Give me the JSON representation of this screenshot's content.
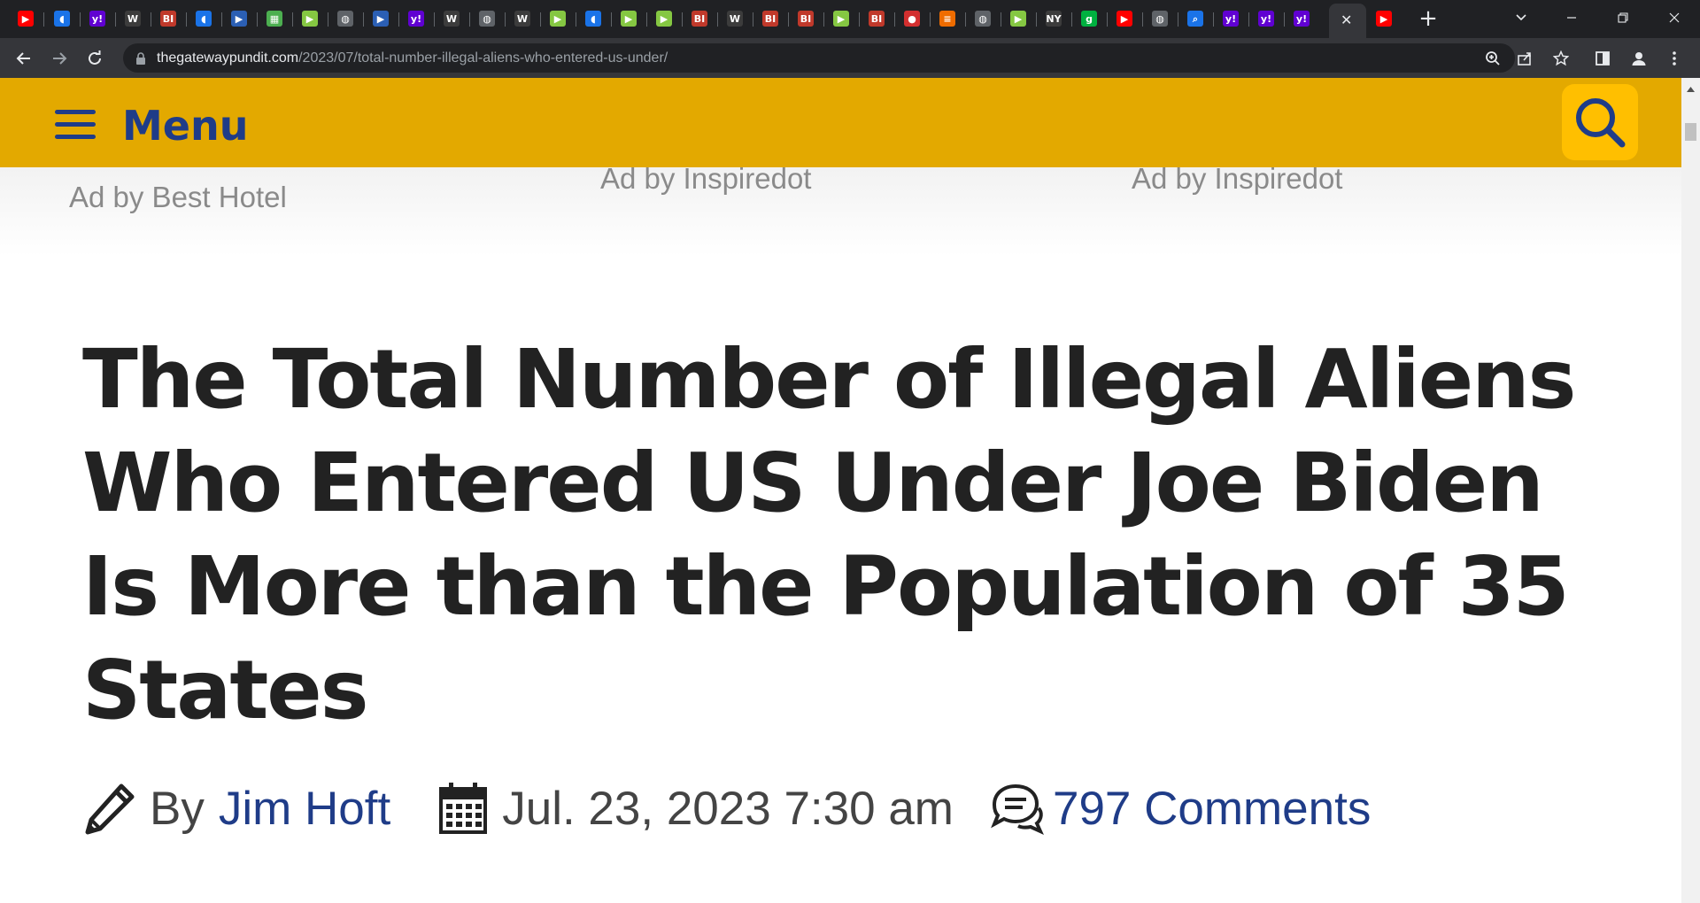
{
  "browser": {
    "tabs": [
      {
        "icon": "youtube-icon",
        "glyph": "▶",
        "bg": "#ff0000"
      },
      {
        "icon": "shield-icon",
        "glyph": "◖",
        "bg": "#1a73e8"
      },
      {
        "icon": "yahoo-icon",
        "glyph": "y!",
        "bg": "#6001d2"
      },
      {
        "icon": "wsj-icon",
        "glyph": "W",
        "bg": "#3c3c3c"
      },
      {
        "icon": "bi-icon",
        "glyph": "BI",
        "bg": "#c0392b"
      },
      {
        "icon": "shield-icon",
        "glyph": "◖",
        "bg": "#1a73e8"
      },
      {
        "icon": "flag-icon",
        "glyph": "▶",
        "bg": "#2b5fb4"
      },
      {
        "icon": "puzzle-icon",
        "glyph": "▦",
        "bg": "#4caf50"
      },
      {
        "icon": "rumble-icon",
        "glyph": "▶",
        "bg": "#85c742"
      },
      {
        "icon": "globe-icon",
        "glyph": "◍",
        "bg": "#5f6368"
      },
      {
        "icon": "flag-icon",
        "glyph": "▶",
        "bg": "#2b5fb4"
      },
      {
        "icon": "yahoo-icon",
        "glyph": "y!",
        "bg": "#6001d2"
      },
      {
        "icon": "wsj-icon",
        "glyph": "W",
        "bg": "#3c3c3c"
      },
      {
        "icon": "globe-icon",
        "glyph": "◍",
        "bg": "#5f6368"
      },
      {
        "icon": "wsj-icon",
        "glyph": "W",
        "bg": "#3c3c3c"
      },
      {
        "icon": "rumble-icon",
        "glyph": "▶",
        "bg": "#85c742"
      },
      {
        "icon": "shield-icon",
        "glyph": "◖",
        "bg": "#1a73e8"
      },
      {
        "icon": "rumble-icon",
        "glyph": "▶",
        "bg": "#85c742"
      },
      {
        "icon": "rumble-icon",
        "glyph": "▶",
        "bg": "#85c742"
      },
      {
        "icon": "bi-icon",
        "glyph": "BI",
        "bg": "#c0392b"
      },
      {
        "icon": "wsj-icon",
        "glyph": "W",
        "bg": "#3c3c3c"
      },
      {
        "icon": "bi-icon",
        "glyph": "BI",
        "bg": "#c0392b"
      },
      {
        "icon": "bi-icon",
        "glyph": "BI",
        "bg": "#c0392b"
      },
      {
        "icon": "rumble-icon",
        "glyph": "▶",
        "bg": "#85c742"
      },
      {
        "icon": "bi-icon",
        "glyph": "BI",
        "bg": "#c0392b"
      },
      {
        "icon": "mic-icon",
        "glyph": "●",
        "bg": "#d32f2f"
      },
      {
        "icon": "bookmark-icon",
        "glyph": "≡",
        "bg": "#ef6c00"
      },
      {
        "icon": "globe-icon",
        "glyph": "◍",
        "bg": "#5f6368"
      },
      {
        "icon": "rumble-icon",
        "glyph": "▶",
        "bg": "#85c742"
      },
      {
        "icon": "news-icon",
        "glyph": "NY",
        "bg": "#3c3c3c"
      },
      {
        "icon": "g-icon",
        "glyph": "g",
        "bg": "#00b140"
      },
      {
        "icon": "youtube-icon",
        "glyph": "▶",
        "bg": "#ff0000"
      },
      {
        "icon": "globe-icon",
        "glyph": "◍",
        "bg": "#5f6368"
      },
      {
        "icon": "search-icon",
        "glyph": "⌕",
        "bg": "#1a73e8"
      },
      {
        "icon": "yahoo-icon",
        "glyph": "y!",
        "bg": "#6001d2"
      },
      {
        "icon": "yahoo-icon",
        "glyph": "y!",
        "bg": "#6001d2"
      },
      {
        "icon": "yahoo-icon",
        "glyph": "y!",
        "bg": "#6001d2"
      }
    ],
    "active_tab_close": "✕",
    "after_tabs": [
      {
        "icon": "youtube-icon",
        "glyph": "▶",
        "bg": "#ff0000"
      }
    ],
    "new_tab": "+",
    "url_host": "thegatewaypundit.com",
    "url_path": "/2023/07/total-number-illegal-aliens-who-entered-us-under/"
  },
  "site": {
    "menu_label": "Menu",
    "brand_color": "#e3a900",
    "link_color": "#1f3c88",
    "ads": [
      "Ad by Best Hotel",
      "Ad by Inspiredot",
      "Ad by Inspiredot"
    ]
  },
  "article": {
    "headline": "The Total Number of Illegal Aliens Who Entered US Under Joe Biden Is More than the Population of 35 States",
    "by_label": "By",
    "author": "Jim Hoft",
    "date": "Jul. 23, 2023 7:30 am",
    "comments": "797 Comments"
  }
}
